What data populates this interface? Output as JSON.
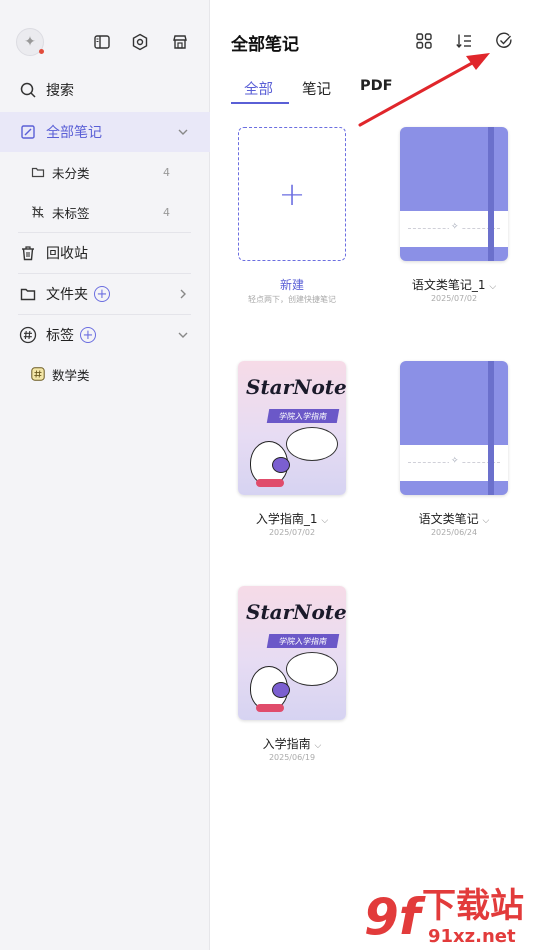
{
  "sidebar": {
    "search_label": "搜索",
    "all_notes_label": "全部笔记",
    "uncategorized_label": "未分类",
    "uncategorized_count": "4",
    "untagged_label": "未标签",
    "untagged_count": "4",
    "trash_label": "回收站",
    "folder_label": "文件夹",
    "tags_label": "标签",
    "tag_items": [
      "数学类"
    ]
  },
  "header": {
    "title": "全部笔记",
    "tabs": [
      "全部",
      "笔记",
      "PDF"
    ],
    "active_tab": "全部"
  },
  "new_card": {
    "title": "新建",
    "hint": "轻点两下，创建快捷笔记",
    "plus": "+"
  },
  "notes": [
    {
      "name": "语文类笔记_1",
      "date": "2025/07/02",
      "cover": "purple-notebook"
    },
    {
      "name": "入学指南_1",
      "date": "2025/07/02",
      "cover": "starnote-guide"
    },
    {
      "name": "语文类笔记",
      "date": "2025/06/24",
      "cover": "purple-notebook"
    },
    {
      "name": "入学指南",
      "date": "2025/06/19",
      "cover": "starnote-guide"
    }
  ],
  "cover_text": {
    "logo": "StarNote",
    "ribbon": "学院入学指南",
    "band_mark": "✧"
  },
  "colors": {
    "accent": "#5a5fd6",
    "notebook": "#8b90e6",
    "annotation_arrow": "#e0262b",
    "watermark": "#e23b3b"
  },
  "watermark": {
    "logo": "9f",
    "text": "下载站",
    "url": "91xz.net"
  }
}
